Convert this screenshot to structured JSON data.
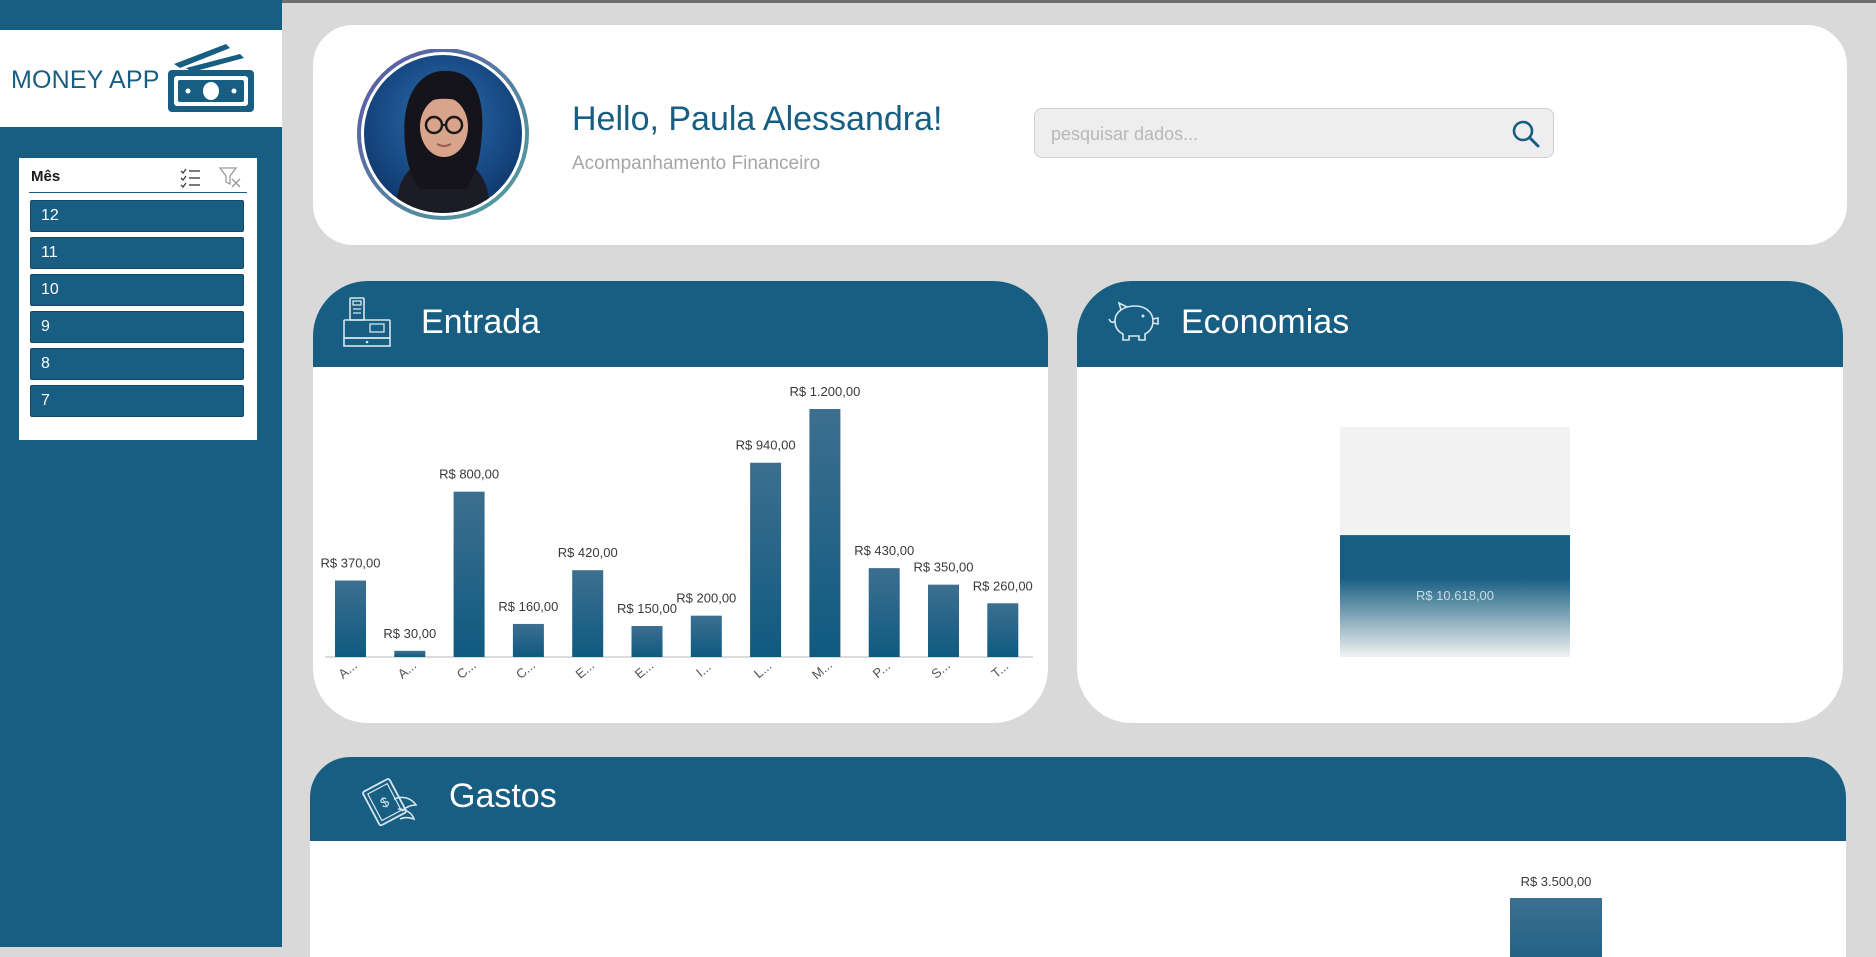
{
  "sidebar": {
    "app_name": "MONEY APP",
    "slicer": {
      "title": "Mês",
      "tools": [
        "multi-select-icon",
        "clear-filter-icon"
      ],
      "items": [
        "12",
        "11",
        "10",
        "9",
        "8",
        "7"
      ]
    }
  },
  "header": {
    "greeting": "Hello, Paula Alessandra!",
    "subtitle": "Acompanhamento Financeiro",
    "search": {
      "placeholder": "pesquisar dados...",
      "icon": "search-icon"
    }
  },
  "entrada": {
    "title": "Entrada",
    "icon": "cash-register-icon"
  },
  "economias": {
    "title": "Economias",
    "icon": "piggy-bank-icon"
  },
  "gastos": {
    "title": "Gastos",
    "icon": "flying-money-icon"
  },
  "colors": {
    "primary": "#175e82",
    "background": "#d9d9d9",
    "accent_light": "#f2f2f2"
  },
  "chart_data": [
    {
      "type": "bar",
      "title": "",
      "categories": [
        "A...",
        "A...",
        "C...",
        "C...",
        "E...",
        "E...",
        "I...",
        "L...",
        "M...",
        "P...",
        "S...",
        "T..."
      ],
      "values": [
        370,
        30,
        800,
        160,
        420,
        150,
        200,
        940,
        1200,
        430,
        350,
        260
      ],
      "value_labels": [
        "R$ 370,00",
        "R$ 30,00",
        "R$ 800,00",
        "R$ 160,00",
        "R$ 420,00",
        "R$ 150,00",
        "R$ 200,00",
        "R$ 940,00",
        "R$ 1.200,00",
        "R$ 430,00",
        "R$ 350,00",
        "R$ 260,00"
      ],
      "ylim": [
        0,
        1200
      ],
      "grid": false
    },
    {
      "type": "bar",
      "title": "",
      "values": [
        10618
      ],
      "value_labels": [
        "R$ 10.618,00"
      ],
      "fill_fraction": 0.53,
      "grid": false
    },
    {
      "type": "bar",
      "title": "",
      "values": [
        3500
      ],
      "value_labels": [
        "R$ 3.500,00"
      ],
      "grid": false
    }
  ]
}
